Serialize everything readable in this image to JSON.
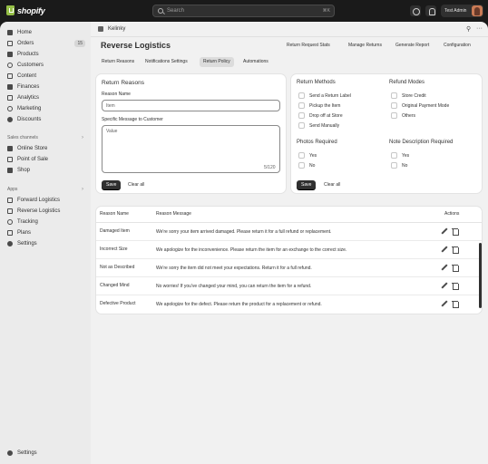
{
  "topbar": {
    "brand": "shopify",
    "search_placeholder": "Search",
    "search_shortcut": "⌘K",
    "user_name": "Test Admin"
  },
  "sidebar": {
    "items": [
      {
        "label": "Home",
        "icon": "home-icon"
      },
      {
        "label": "Orders",
        "icon": "orders-icon",
        "badge": "15"
      },
      {
        "label": "Products",
        "icon": "tag-icon"
      },
      {
        "label": "Customers",
        "icon": "person-icon"
      },
      {
        "label": "Content",
        "icon": "content-icon"
      },
      {
        "label": "Finances",
        "icon": "bank-icon"
      },
      {
        "label": "Analytics",
        "icon": "chart-icon"
      },
      {
        "label": "Marketing",
        "icon": "target-icon"
      },
      {
        "label": "Discounts",
        "icon": "discount-icon"
      }
    ],
    "sales_channels_label": "Sales channels",
    "sales_channels": [
      {
        "label": "Online Store"
      },
      {
        "label": "Point of Sale"
      },
      {
        "label": "Shop"
      }
    ],
    "apps_label": "Apps",
    "apps": [
      {
        "label": "Forward Logistics"
      },
      {
        "label": "Reverse Logistics"
      },
      {
        "label": "Tracking"
      },
      {
        "label": "Plans"
      },
      {
        "label": "Settings"
      }
    ],
    "bottom_settings": "Settings"
  },
  "main": {
    "breadcrumb": "Kelinky",
    "title": "Reverse Logistics",
    "header_links": [
      "Return Request Stats",
      "Manage Returns",
      "Generate Report",
      "Configuration"
    ],
    "tabs": [
      "Return Reasons",
      "Notifications Settings",
      "Return Policy",
      "Automations"
    ],
    "active_tab": "Return Policy"
  },
  "return_reasons_card": {
    "title": "Return Reasons",
    "reason_name_label": "Reason Name",
    "reason_name_placeholder": "Item",
    "message_label": "Specific Message to Customer",
    "message_placeholder": "Value",
    "counter": "5/120",
    "save": "Save",
    "clear": "Clear all"
  },
  "settings_card": {
    "return_methods_title": "Return Methods",
    "return_methods": [
      "Send a Return Label",
      "Pickup the Item",
      "Drop off at Store",
      "Send Manually"
    ],
    "refund_modes_title": "Refund Modes",
    "refund_modes": [
      "Store Credit",
      "Original Payment Mode",
      "Others"
    ],
    "photos_required_title": "Photos Required",
    "photos_required": [
      "Yes",
      "No"
    ],
    "note_required_title": "Note Description Required",
    "note_required": [
      "Yes",
      "No"
    ],
    "save": "Save",
    "clear": "Clear all"
  },
  "reasons_table": {
    "columns": [
      "Reason Name",
      "Reason Message",
      "Actions"
    ],
    "rows": [
      {
        "name": "Damaged Item",
        "message": "We're sorry your item arrived damaged. Please return it for a full refund or replacement."
      },
      {
        "name": "Incorrect Size",
        "message": "We apologize for the inconvenience. Please return the item for an exchange to the correct size."
      },
      {
        "name": "Not as Described",
        "message": "We're sorry the item did not meet your expectations. Return it for a full refund."
      },
      {
        "name": "Changed Mind",
        "message": "No worries! If you've changed your mind, you can return the item for a refund."
      },
      {
        "name": "Defective Product",
        "message": "We apologize for the defect. Please return the product for a replacement or refund."
      }
    ]
  },
  "colors": {
    "brand_green": "#95bf47",
    "topbar": "#1a1a1a",
    "primary_button": "#303030"
  }
}
